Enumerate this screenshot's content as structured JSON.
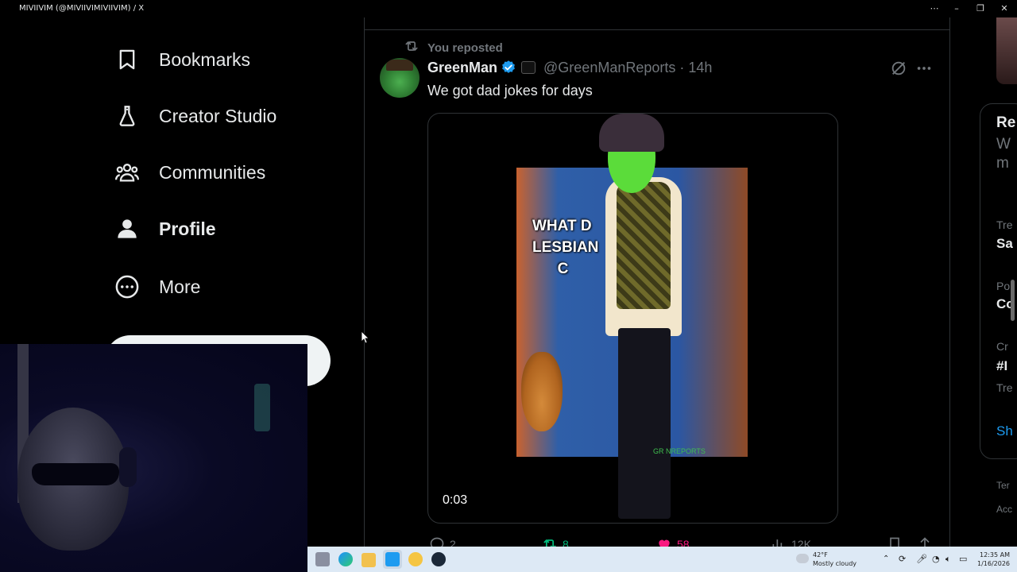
{
  "window": {
    "title": "MIVIIVIM (@MIVIIVIMIVIIVIM) / X"
  },
  "sidebar": {
    "items": [
      {
        "label": "Bookmarks",
        "icon": "bookmark-icon"
      },
      {
        "label": "Creator Studio",
        "icon": "flask-icon"
      },
      {
        "label": "Communities",
        "icon": "communities-icon"
      },
      {
        "label": "Profile",
        "icon": "person-icon"
      },
      {
        "label": "More",
        "icon": "more-circle-icon"
      }
    ]
  },
  "post": {
    "repost_label": "You reposted",
    "author_name": "GreenMan",
    "handle": "@GreenManReports",
    "separator": "·",
    "time": "14h",
    "text": "We got dad jokes for days",
    "video": {
      "caption": "WHAT D\nLESBIAN\n      C",
      "watermark": "GR       NREPORTS",
      "duration": "0:03"
    },
    "actions": {
      "replies": "2",
      "reposts": "8",
      "likes": "58",
      "views": "12K"
    }
  },
  "right_sidebar": {
    "fragments": [
      "Re",
      "W",
      "m",
      "Tre",
      "Sa",
      "Po",
      "Co",
      "Cr",
      "#I",
      "Tre",
      "Sh",
      "Ter",
      "Acc"
    ]
  },
  "taskbar": {
    "weather_temp": "42°F",
    "weather_desc": "Mostly cloudy",
    "time": "12:35 AM",
    "date": "1/16/2026"
  },
  "colors": {
    "background": "#000000",
    "text": "#e7e9ea",
    "muted": "#71767b",
    "accent": "#1d9bf0",
    "repost_green": "#00ba7c",
    "like_pink": "#f91880"
  }
}
